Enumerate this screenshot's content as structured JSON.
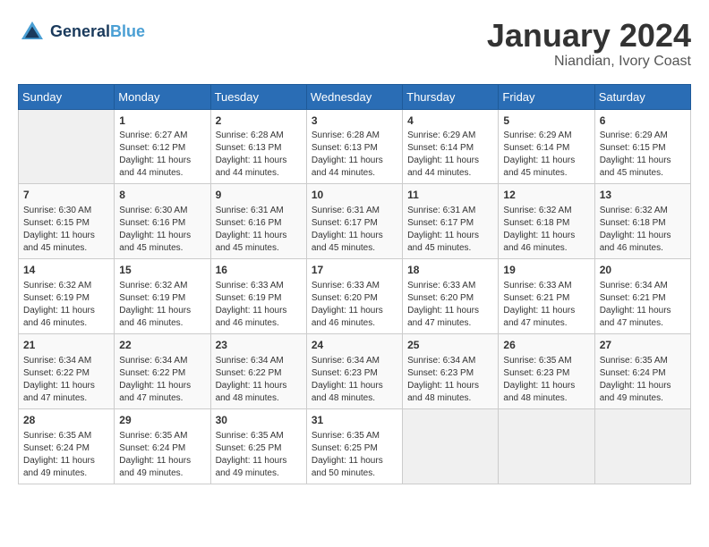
{
  "header": {
    "logo_line1": "General",
    "logo_line2": "Blue",
    "month": "January 2024",
    "location": "Niandian, Ivory Coast"
  },
  "days_of_week": [
    "Sunday",
    "Monday",
    "Tuesday",
    "Wednesday",
    "Thursday",
    "Friday",
    "Saturday"
  ],
  "weeks": [
    [
      {
        "day": "",
        "sunrise": "",
        "sunset": "",
        "daylight": ""
      },
      {
        "day": "1",
        "sunrise": "6:27 AM",
        "sunset": "6:12 PM",
        "daylight": "11 hours and 44 minutes."
      },
      {
        "day": "2",
        "sunrise": "6:28 AM",
        "sunset": "6:13 PM",
        "daylight": "11 hours and 44 minutes."
      },
      {
        "day": "3",
        "sunrise": "6:28 AM",
        "sunset": "6:13 PM",
        "daylight": "11 hours and 44 minutes."
      },
      {
        "day": "4",
        "sunrise": "6:29 AM",
        "sunset": "6:14 PM",
        "daylight": "11 hours and 44 minutes."
      },
      {
        "day": "5",
        "sunrise": "6:29 AM",
        "sunset": "6:14 PM",
        "daylight": "11 hours and 45 minutes."
      },
      {
        "day": "6",
        "sunrise": "6:29 AM",
        "sunset": "6:15 PM",
        "daylight": "11 hours and 45 minutes."
      }
    ],
    [
      {
        "day": "7",
        "sunrise": "6:30 AM",
        "sunset": "6:15 PM",
        "daylight": "11 hours and 45 minutes."
      },
      {
        "day": "8",
        "sunrise": "6:30 AM",
        "sunset": "6:16 PM",
        "daylight": "11 hours and 45 minutes."
      },
      {
        "day": "9",
        "sunrise": "6:31 AM",
        "sunset": "6:16 PM",
        "daylight": "11 hours and 45 minutes."
      },
      {
        "day": "10",
        "sunrise": "6:31 AM",
        "sunset": "6:17 PM",
        "daylight": "11 hours and 45 minutes."
      },
      {
        "day": "11",
        "sunrise": "6:31 AM",
        "sunset": "6:17 PM",
        "daylight": "11 hours and 45 minutes."
      },
      {
        "day": "12",
        "sunrise": "6:32 AM",
        "sunset": "6:18 PM",
        "daylight": "11 hours and 46 minutes."
      },
      {
        "day": "13",
        "sunrise": "6:32 AM",
        "sunset": "6:18 PM",
        "daylight": "11 hours and 46 minutes."
      }
    ],
    [
      {
        "day": "14",
        "sunrise": "6:32 AM",
        "sunset": "6:19 PM",
        "daylight": "11 hours and 46 minutes."
      },
      {
        "day": "15",
        "sunrise": "6:32 AM",
        "sunset": "6:19 PM",
        "daylight": "11 hours and 46 minutes."
      },
      {
        "day": "16",
        "sunrise": "6:33 AM",
        "sunset": "6:19 PM",
        "daylight": "11 hours and 46 minutes."
      },
      {
        "day": "17",
        "sunrise": "6:33 AM",
        "sunset": "6:20 PM",
        "daylight": "11 hours and 46 minutes."
      },
      {
        "day": "18",
        "sunrise": "6:33 AM",
        "sunset": "6:20 PM",
        "daylight": "11 hours and 47 minutes."
      },
      {
        "day": "19",
        "sunrise": "6:33 AM",
        "sunset": "6:21 PM",
        "daylight": "11 hours and 47 minutes."
      },
      {
        "day": "20",
        "sunrise": "6:34 AM",
        "sunset": "6:21 PM",
        "daylight": "11 hours and 47 minutes."
      }
    ],
    [
      {
        "day": "21",
        "sunrise": "6:34 AM",
        "sunset": "6:22 PM",
        "daylight": "11 hours and 47 minutes."
      },
      {
        "day": "22",
        "sunrise": "6:34 AM",
        "sunset": "6:22 PM",
        "daylight": "11 hours and 47 minutes."
      },
      {
        "day": "23",
        "sunrise": "6:34 AM",
        "sunset": "6:22 PM",
        "daylight": "11 hours and 48 minutes."
      },
      {
        "day": "24",
        "sunrise": "6:34 AM",
        "sunset": "6:23 PM",
        "daylight": "11 hours and 48 minutes."
      },
      {
        "day": "25",
        "sunrise": "6:34 AM",
        "sunset": "6:23 PM",
        "daylight": "11 hours and 48 minutes."
      },
      {
        "day": "26",
        "sunrise": "6:35 AM",
        "sunset": "6:23 PM",
        "daylight": "11 hours and 48 minutes."
      },
      {
        "day": "27",
        "sunrise": "6:35 AM",
        "sunset": "6:24 PM",
        "daylight": "11 hours and 49 minutes."
      }
    ],
    [
      {
        "day": "28",
        "sunrise": "6:35 AM",
        "sunset": "6:24 PM",
        "daylight": "11 hours and 49 minutes."
      },
      {
        "day": "29",
        "sunrise": "6:35 AM",
        "sunset": "6:24 PM",
        "daylight": "11 hours and 49 minutes."
      },
      {
        "day": "30",
        "sunrise": "6:35 AM",
        "sunset": "6:25 PM",
        "daylight": "11 hours and 49 minutes."
      },
      {
        "day": "31",
        "sunrise": "6:35 AM",
        "sunset": "6:25 PM",
        "daylight": "11 hours and 50 minutes."
      },
      {
        "day": "",
        "sunrise": "",
        "sunset": "",
        "daylight": ""
      },
      {
        "day": "",
        "sunrise": "",
        "sunset": "",
        "daylight": ""
      },
      {
        "day": "",
        "sunrise": "",
        "sunset": "",
        "daylight": ""
      }
    ]
  ]
}
